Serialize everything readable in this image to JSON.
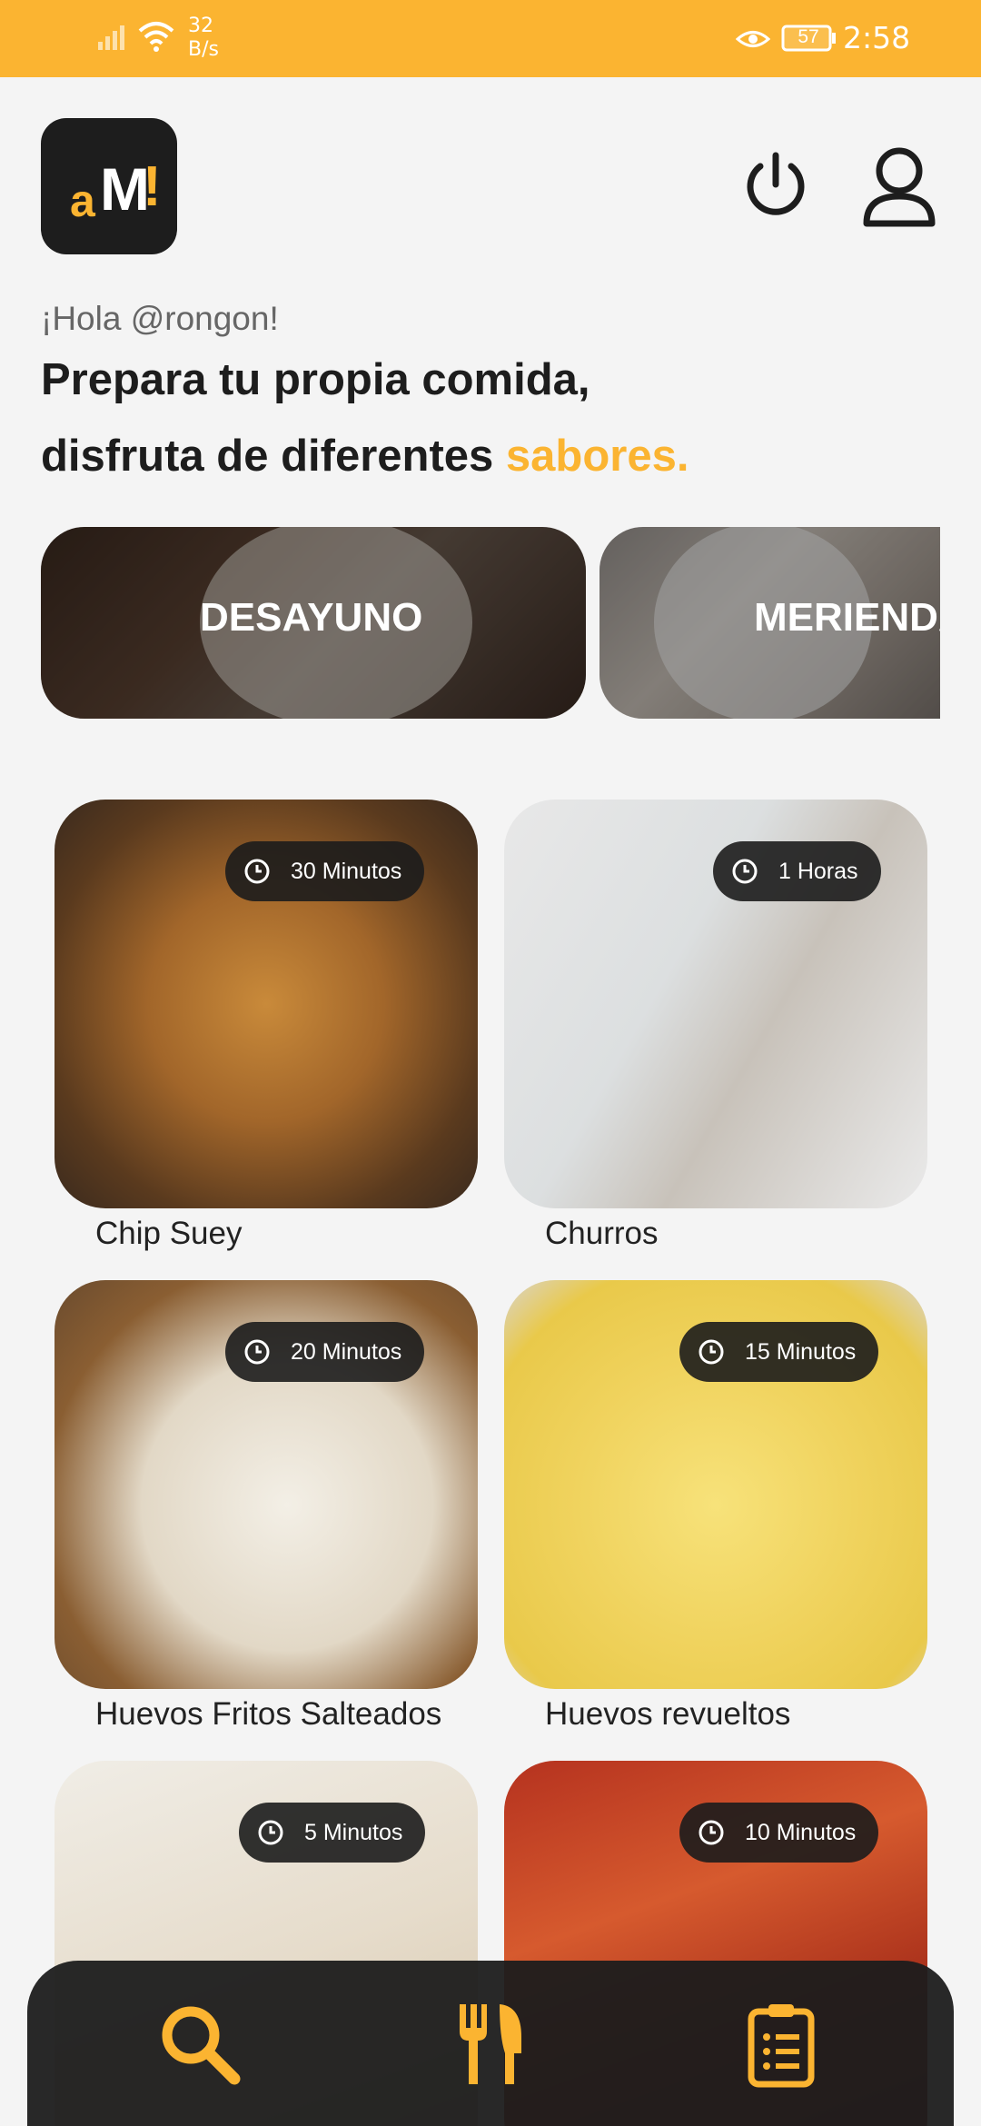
{
  "status_bar": {
    "network_speed": "32\nB/s",
    "battery": "57",
    "time": "2:58"
  },
  "app": {
    "logo_text": "aM!",
    "brand_color": "#fbb431"
  },
  "greeting": {
    "hello": "¡Hola @rongon!",
    "headline_line1": "Prepara tu propia comida,",
    "headline_line2_prefix": "disfruta de diferentes",
    "headline_line2_accent": "sabores."
  },
  "categories": [
    {
      "label": "DESAYUNO"
    },
    {
      "label": "MERIENDA"
    }
  ],
  "recipes": [
    {
      "name": "Chip Suey",
      "time": "30 Minutos"
    },
    {
      "name": "Churros",
      "time": "1 Horas"
    },
    {
      "name": "Huevos Fritos Salteados",
      "time": "20 Minutos"
    },
    {
      "name": "Huevos revueltos",
      "time": "15 Minutos"
    },
    {
      "name": "",
      "time": "5 Minutos"
    },
    {
      "name": "",
      "time": "10 Minutos"
    }
  ],
  "bottom_nav": [
    {
      "icon": "search-icon"
    },
    {
      "icon": "utensils-icon"
    },
    {
      "icon": "clipboard-list-icon"
    }
  ]
}
